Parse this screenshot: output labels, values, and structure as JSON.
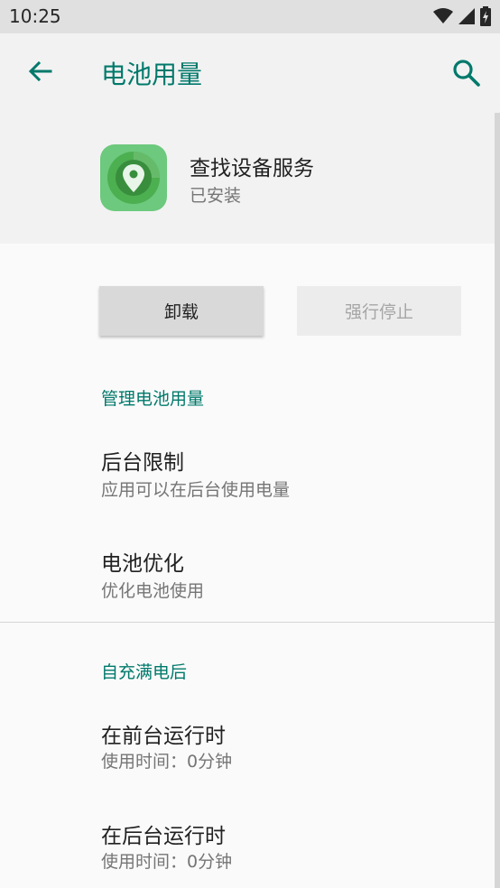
{
  "status_bar": {
    "time": "10:25",
    "icons": [
      "wifi-icon",
      "signal-icon",
      "battery-icon"
    ]
  },
  "app_bar": {
    "title": "电池用量",
    "back_icon": "arrow-back-icon",
    "search_icon": "search-icon",
    "accent_color": "#00796b"
  },
  "app": {
    "name": "查找设备服务",
    "status": "已安装",
    "icon": "location-pin-icon"
  },
  "actions": {
    "uninstall_label": "卸载",
    "force_stop_label": "强行停止"
  },
  "sections": [
    {
      "title": "管理电池用量",
      "items": [
        {
          "title": "后台限制",
          "summary": "应用可以在后台使用电量"
        },
        {
          "title": "电池优化",
          "summary": "优化电池使用"
        }
      ]
    },
    {
      "title": "自充满电后",
      "items": [
        {
          "title": "在前台运行时",
          "summary": "使用时间：0分钟"
        },
        {
          "title": "在后台运行时",
          "summary": "使用时间：0分钟"
        }
      ]
    }
  ]
}
